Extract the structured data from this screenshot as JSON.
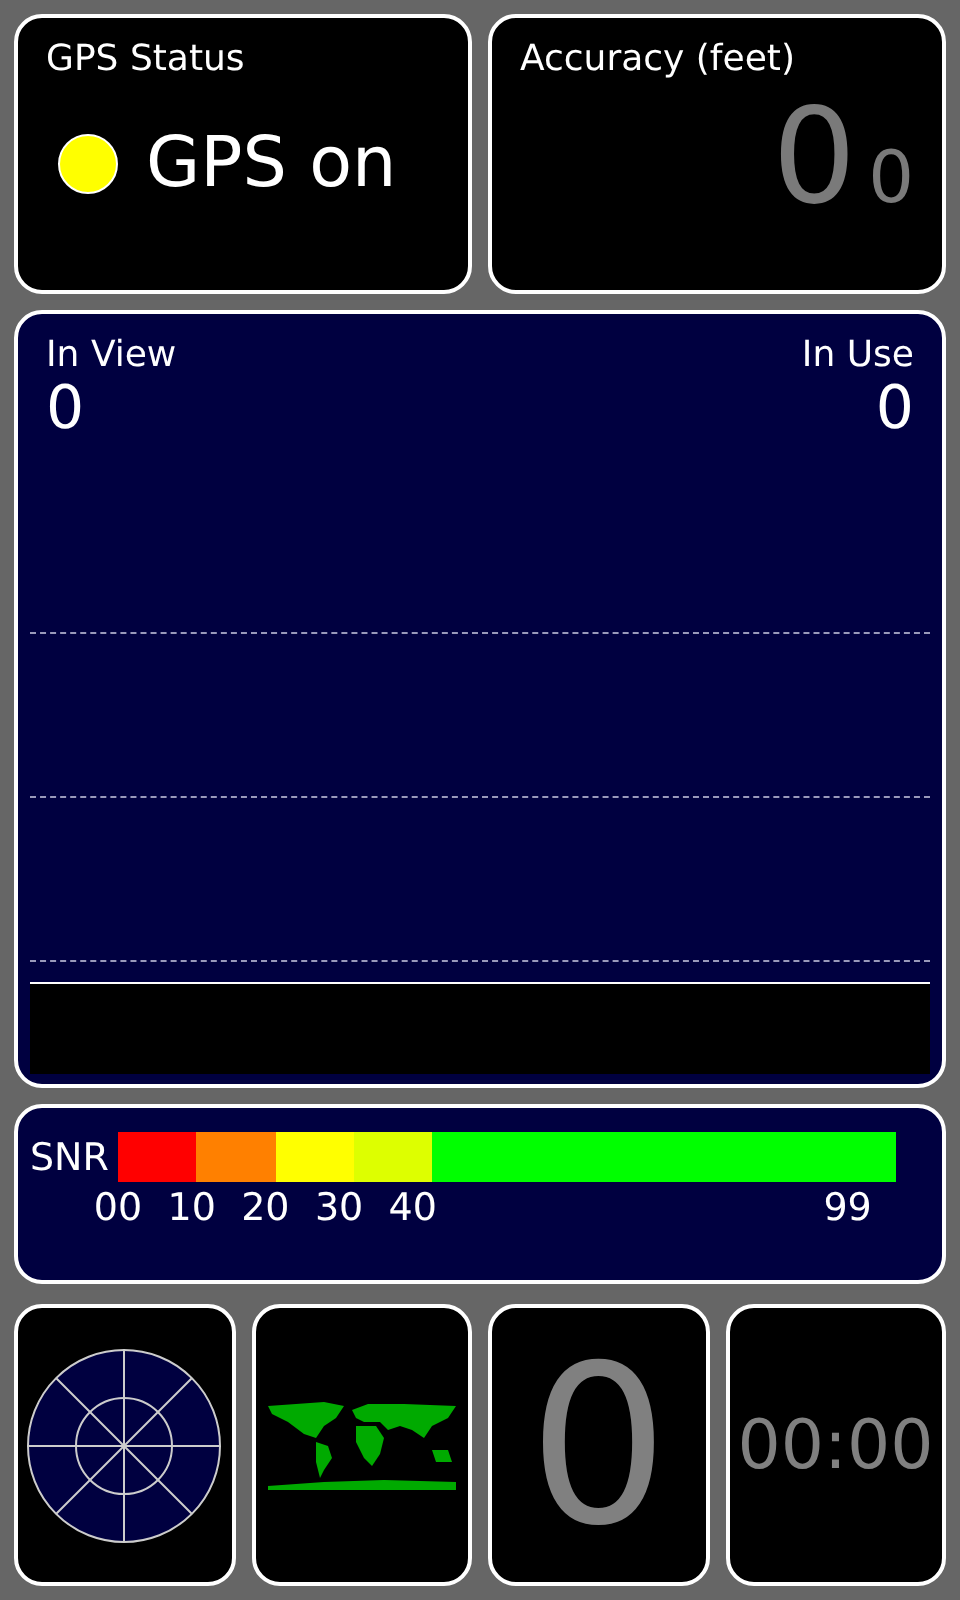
{
  "gps_status": {
    "title": "GPS Status",
    "status": "GPS on",
    "color": "#ffff00"
  },
  "accuracy": {
    "title": "Accuracy (feet)",
    "value": "0",
    "secondary_value": "0"
  },
  "satellites": {
    "in_view_label": "In View",
    "in_view": "0",
    "in_use_label": "In Use",
    "in_use": "0"
  },
  "snr": {
    "label": "SNR",
    "segments": [
      {
        "color": "#ff0000"
      },
      {
        "color": "#ff8000"
      },
      {
        "color": "#ffff00"
      },
      {
        "color": "#ddff00"
      },
      {
        "color": "#00ff00"
      }
    ],
    "ticks": [
      "00",
      "10",
      "20",
      "30",
      "40",
      "99"
    ]
  },
  "bottom": {
    "count": "0",
    "timer": "00:00"
  }
}
